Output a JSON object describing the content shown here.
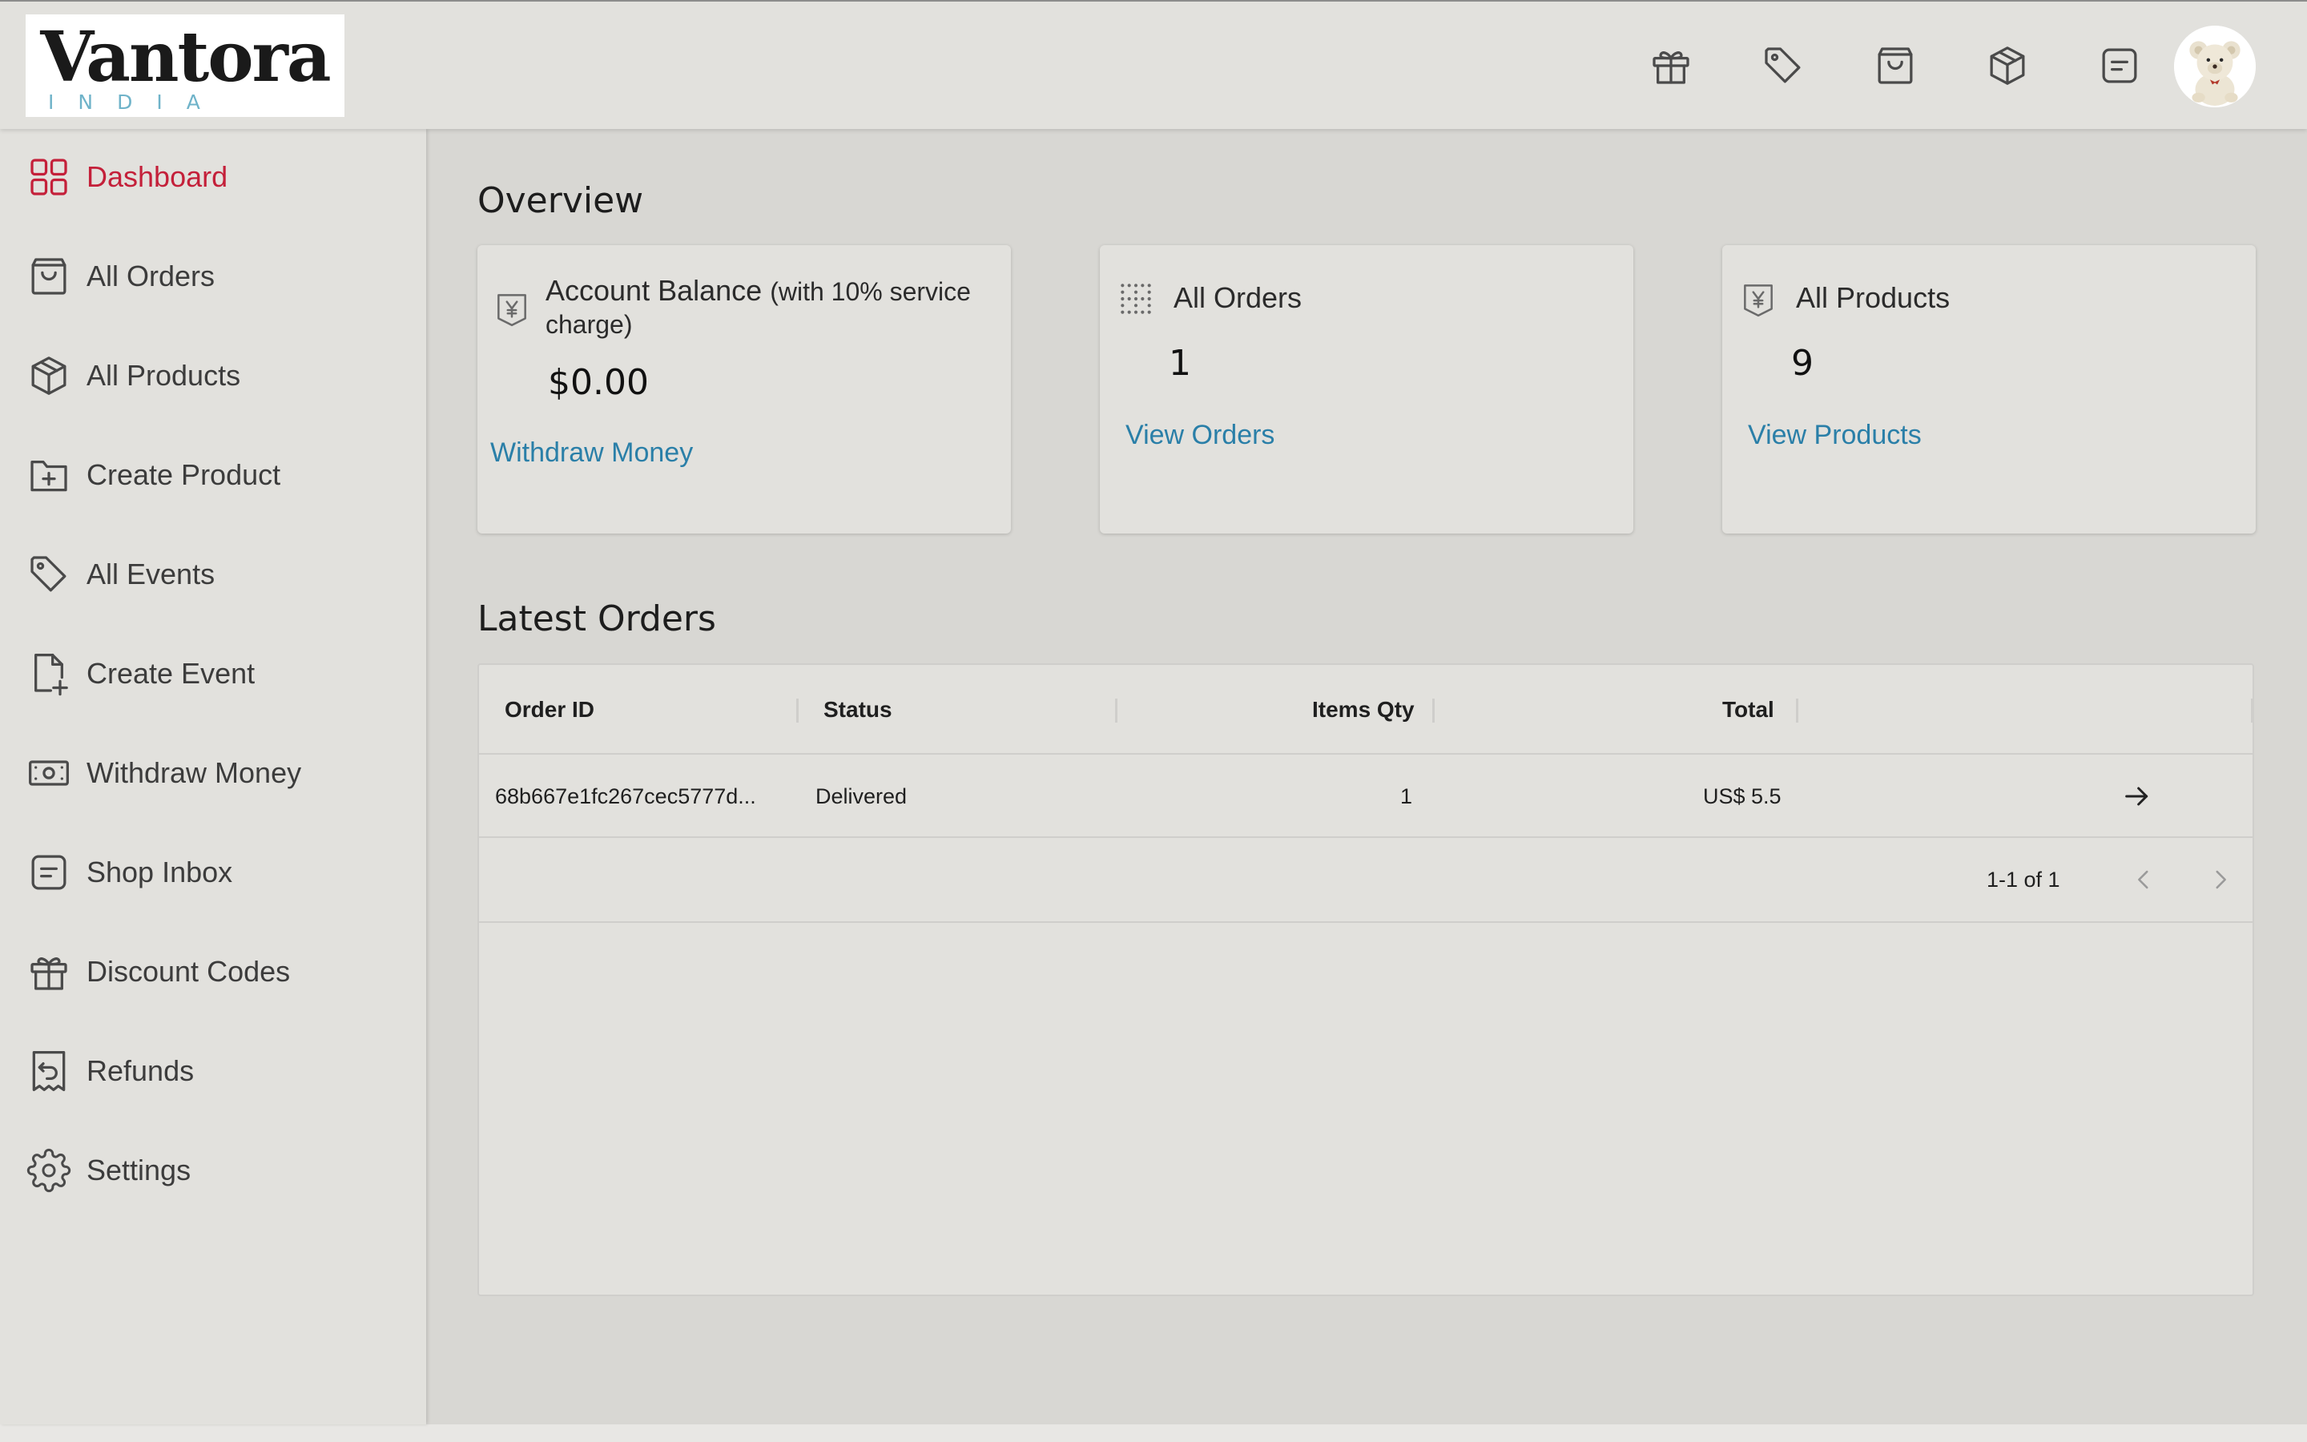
{
  "brand": {
    "name": "Vantora",
    "sub": "INDIA"
  },
  "header": {
    "icons": [
      "gift-icon",
      "tag-icon",
      "shopping-bag-icon",
      "package-icon",
      "message-icon"
    ],
    "avatar": "teddy-bear-avatar"
  },
  "sidebar": {
    "items": [
      {
        "label": "Dashboard",
        "icon": "dashboard-grid-icon",
        "active": true
      },
      {
        "label": "All Orders",
        "icon": "shopping-bag-icon"
      },
      {
        "label": "All Products",
        "icon": "package-icon"
      },
      {
        "label": "Create Product",
        "icon": "folder-plus-icon"
      },
      {
        "label": "All Events",
        "icon": "tag-icon"
      },
      {
        "label": "Create Event",
        "icon": "file-plus-icon"
      },
      {
        "label": "Withdraw Money",
        "icon": "money-icon"
      },
      {
        "label": "Shop Inbox",
        "icon": "message-icon"
      },
      {
        "label": "Discount Codes",
        "icon": "gift-icon"
      },
      {
        "label": "Refunds",
        "icon": "receipt-refund-icon"
      },
      {
        "label": "Settings",
        "icon": "settings-gear-icon"
      }
    ]
  },
  "overview": {
    "title": "Overview",
    "cards": [
      {
        "title": "Account Balance",
        "title_note": "(with 10% service",
        "title_note2": "charge)",
        "value": "$0.00",
        "link": "Withdraw Money",
        "icon": "yen-badge-icon"
      },
      {
        "title": "All Orders",
        "value": "1",
        "link": "View Orders",
        "icon": "dotted-grid-icon"
      },
      {
        "title": "All Products",
        "value": "9",
        "link": "View Products",
        "icon": "yen-badge-icon"
      }
    ]
  },
  "latest_orders": {
    "title": "Latest Orders",
    "columns": [
      "Order ID",
      "Status",
      "Items Qty",
      "Total"
    ],
    "rows": [
      {
        "order_id": "68b667e1fc267cec5777d...",
        "status": "Delivered",
        "qty": "1",
        "total": "US$ 5.5"
      }
    ],
    "pagination": "1-1 of 1"
  },
  "colors": {
    "accent": "#c4203a",
    "link": "#2a7fa8",
    "background": "#d8d7d3",
    "surface": "#e2e1dd"
  }
}
